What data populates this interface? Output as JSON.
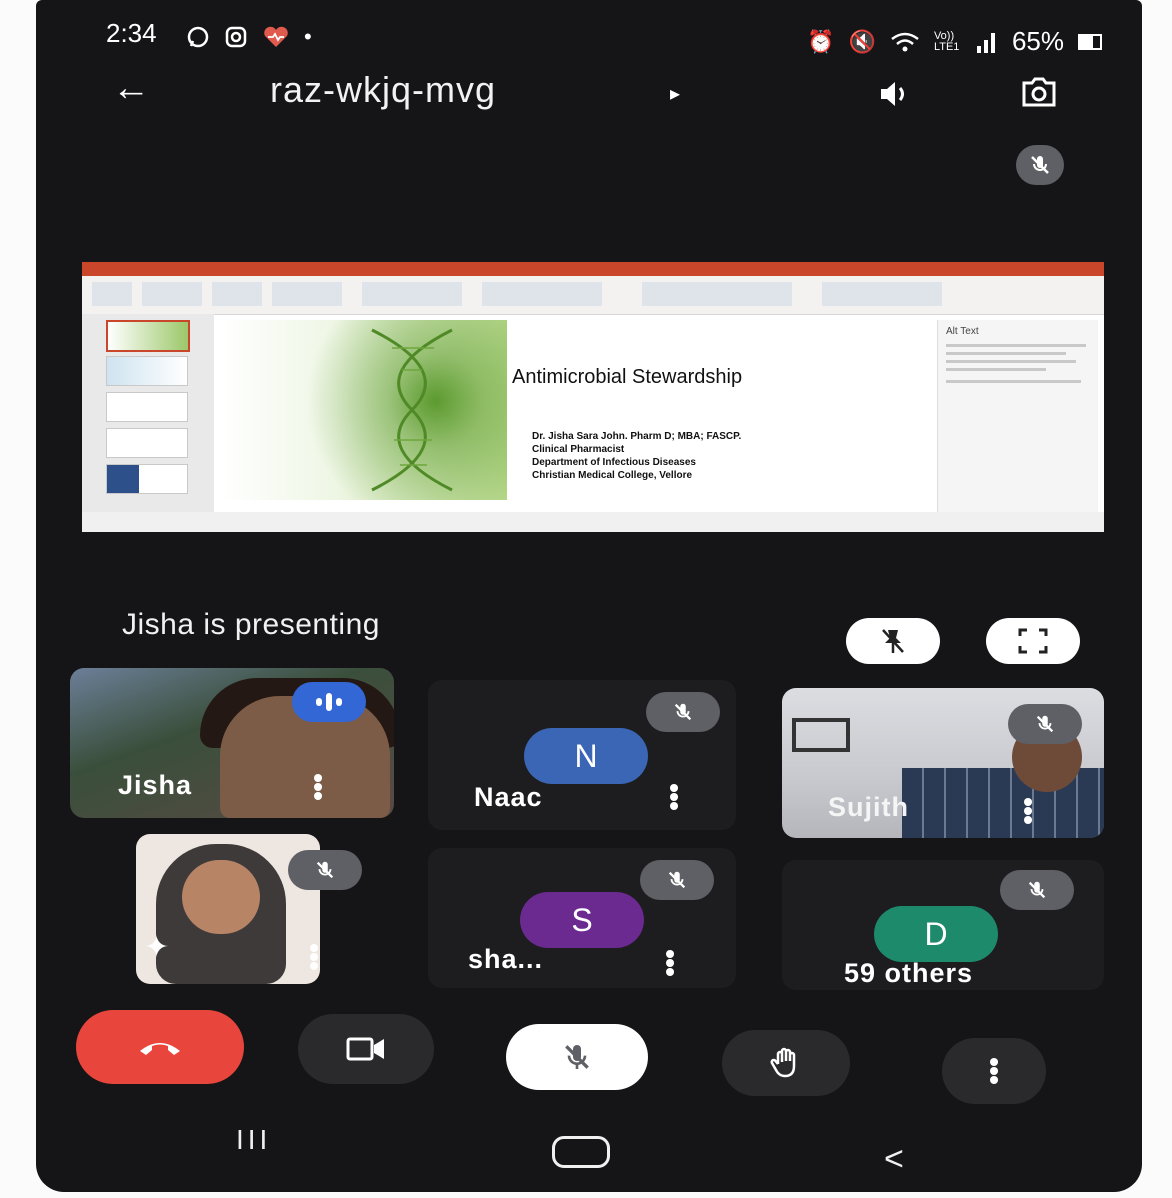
{
  "status_bar": {
    "time": "2:34",
    "left_icons": [
      "whatsapp-icon",
      "instagram-icon",
      "heart-icon"
    ],
    "dot": "•",
    "right_icons": [
      "alarm-icon",
      "mute-icon",
      "wifi-icon",
      "volte-icon",
      "signal-icon"
    ],
    "volte": "Vo)) LTE1",
    "battery": "65%"
  },
  "header": {
    "meeting_code": "raz-wkjq-mvg",
    "caret": "▸",
    "back": "←",
    "speaker": "🔈"
  },
  "presentation": {
    "slide_title": "Antimicrobial Stewardship",
    "authors": [
      "Dr. Jisha Sara John. Pharm D; MBA; FASCP.",
      "Clinical Pharmacist",
      "Department of Infectious Diseases",
      "Christian Medical College, Vellore"
    ],
    "pane_title": "Alt Text",
    "presenting_label": "Jisha is presenting"
  },
  "participants": [
    {
      "name": "Jisha",
      "state": "speaking"
    },
    {
      "name": "Naac",
      "avatar": "N",
      "avatar_color": "#3b66b5",
      "state": "muted"
    },
    {
      "name": "Sujith",
      "state": "muted"
    },
    {
      "name": "",
      "state": "muted"
    },
    {
      "name": "sha...",
      "avatar": "S",
      "avatar_color": "#6a2a8f",
      "state": "muted"
    },
    {
      "name": "59 others",
      "avatar": "D",
      "avatar_color": "#1d8a6b",
      "state": "muted"
    }
  ],
  "controls": {
    "end_call_color": "#e8463c",
    "items": [
      "end-call",
      "camera",
      "microphone",
      "raise-hand",
      "more-options"
    ]
  },
  "nav": {
    "recents": "III",
    "back": "<"
  }
}
